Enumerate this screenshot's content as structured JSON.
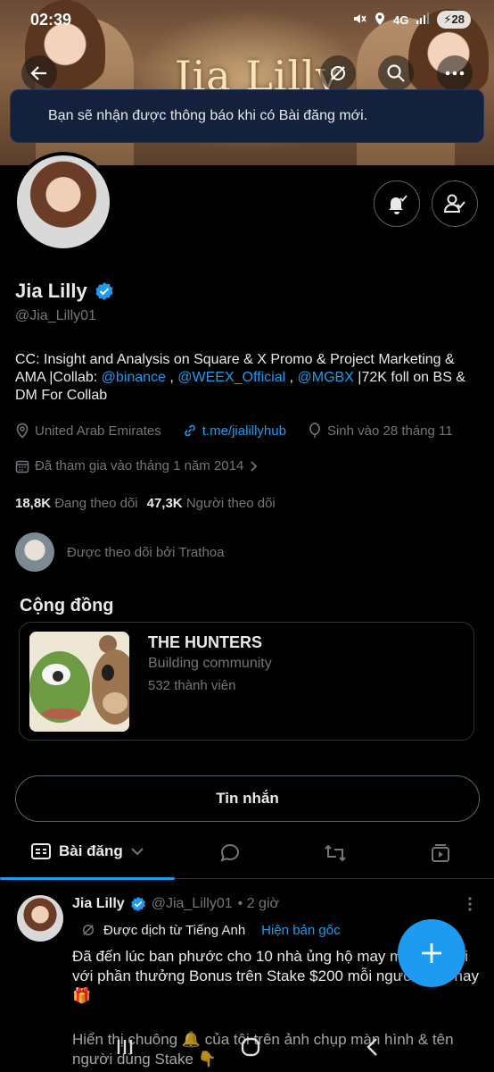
{
  "status_bar": {
    "time": "02:39",
    "network": "4G",
    "battery": "28"
  },
  "banner": {
    "title": "Jia Lilly"
  },
  "toast": {
    "text": "Bạn sẽ nhận được thông báo khi có Bài đăng mới."
  },
  "profile": {
    "name": "Jia Lilly",
    "handle": "@Jia_Lilly01",
    "bio_part1": "CC: Insight and Analysis on Square & X Promo & Project Marketing & AMA |Collab: ",
    "bio_link1": "@binance",
    "bio_sep1": " , ",
    "bio_link2": "@WEEX_Official",
    "bio_sep2": " , ",
    "bio_link3": "@MGBX",
    "bio_part2": " |72K foll on BS & DM For Collab",
    "location": "United Arab Emirates",
    "website": "t.me/jialillyhub",
    "birthday": "Sinh vào 28 tháng 11",
    "joined": "Đã tham gia vào tháng 1 năm 2014",
    "following_count": "18,8K",
    "following_label": "Đang theo dõi",
    "followers_count": "47,3K",
    "followers_label": "Người theo dõi",
    "followed_by": "Được theo dõi bởi Trathoa"
  },
  "community": {
    "section_title": "Cộng đồng",
    "name": "THE HUNTERS",
    "subtitle": "Building community",
    "members": "532 thành viên"
  },
  "message_button": "Tin nhắn",
  "tabs": {
    "active_label": "Bài đăng"
  },
  "post": {
    "author": "Jia Lilly",
    "handle": "@Jia_Lilly01",
    "time": "• 2 giờ",
    "translated": "Được dịch từ Tiếng Anh",
    "show_original": "Hiện bản gốc",
    "text": "Đã đến lúc ban phước cho 10 nhà ủng hộ may mắn của tôi với phần thưởng Bonus trên Stake $200 mỗi người hôm nay 🎁",
    "text2": "Hiển thị chuông 🔔 của tôi trên ảnh chụp màn hình & tên người dùng Stake 👇"
  },
  "colors": {
    "accent": "#1d9bf0",
    "toast_bg": "#14213d",
    "muted": "#71767b"
  }
}
